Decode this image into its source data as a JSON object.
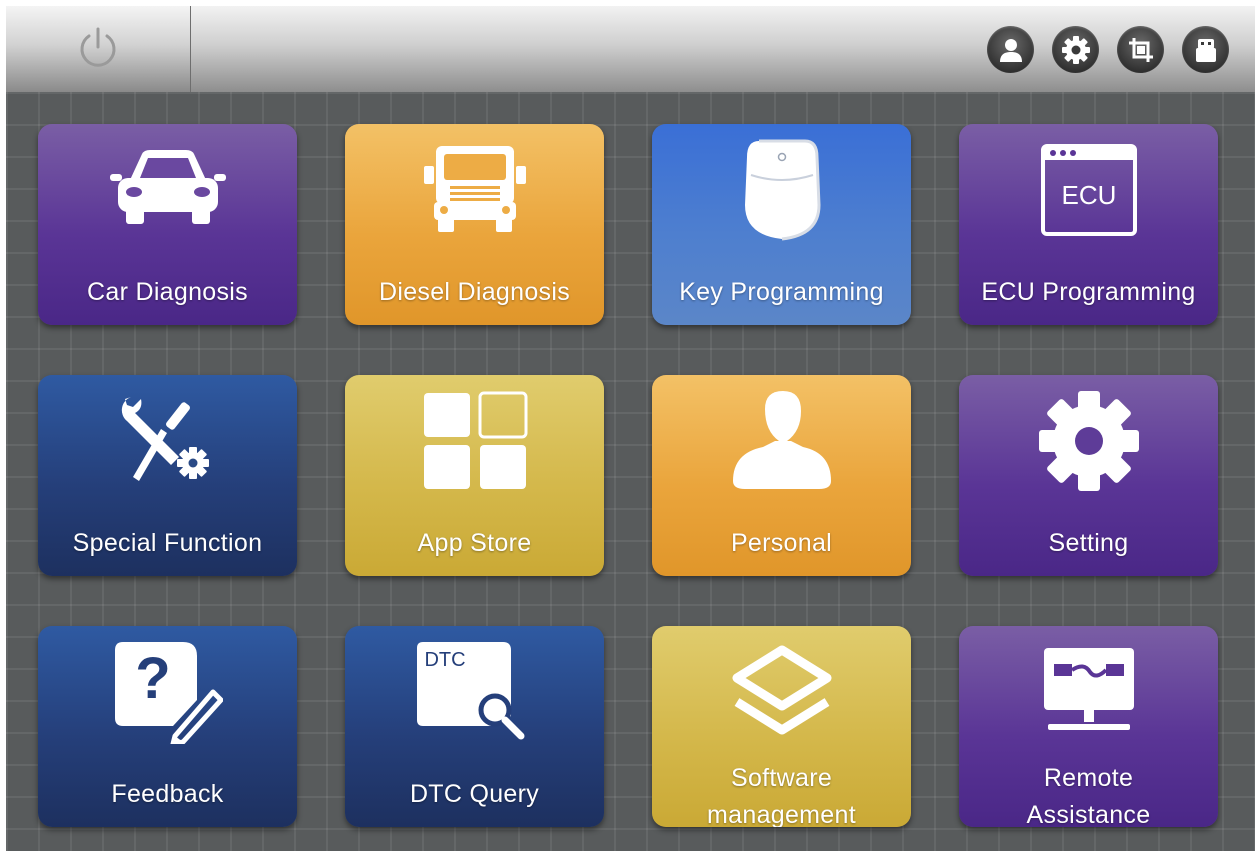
{
  "header": {
    "power_icon": "power-icon",
    "right_icons": [
      "user-icon",
      "gear-icon",
      "crop-icon",
      "usb-icon"
    ]
  },
  "tiles": [
    {
      "label": "Car Diagnosis",
      "icon": "car-icon",
      "color": "#5a3596"
    },
    {
      "label": "Diesel Diagnosis",
      "icon": "truck-icon",
      "color": "#eaa53c"
    },
    {
      "label": "Key Programming",
      "icon": "car-key-icon",
      "color": "#4e7fcf"
    },
    {
      "label": "ECU Programming",
      "icon": "ecu-window-icon",
      "icon_text": "ECU",
      "color": "#5a3596"
    },
    {
      "label": "Special Function",
      "icon": "wrench-screwdriver-gear-icon",
      "color": "#253f7a"
    },
    {
      "label": "App Store",
      "icon": "app-grid-icon",
      "color": "#d4b84b"
    },
    {
      "label": "Personal",
      "icon": "person-icon",
      "color": "#eaa53c"
    },
    {
      "label": "Setting",
      "icon": "gear-icon",
      "color": "#5a3596"
    },
    {
      "label": "Feedback",
      "icon": "question-pencil-icon",
      "color": "#253f7a"
    },
    {
      "label": "DTC Query",
      "icon": "dtc-search-icon",
      "icon_text": "DTC",
      "color": "#253f7a"
    },
    {
      "label_line1": "Software",
      "label_line2": "management",
      "icon": "layers-icon",
      "color": "#d4b84b"
    },
    {
      "label_line1": "Remote",
      "label_line2": "Assistance",
      "icon": "remote-monitor-icon",
      "color": "#5a3596"
    }
  ]
}
